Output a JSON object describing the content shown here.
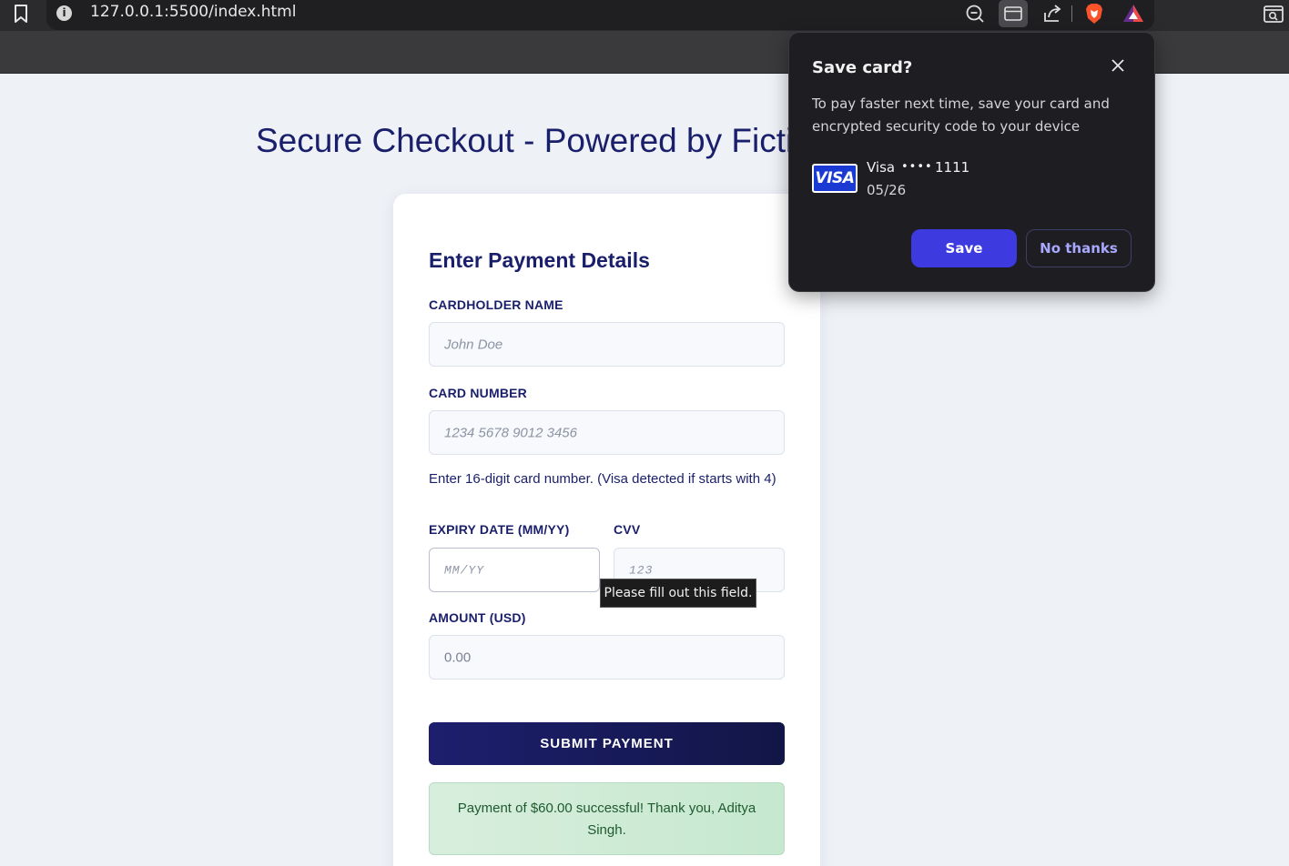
{
  "browser": {
    "url": "127.0.0.1:5500/index.html",
    "info_icon": "i",
    "icons": [
      "bookmark-icon",
      "info-icon",
      "zoom-out-icon",
      "credit-card-icon",
      "share-icon",
      "brave-shield-icon",
      "brave-rewards-icon",
      "tab-search-icon"
    ]
  },
  "page": {
    "title": "Secure Checkout - Powered by Fictio",
    "form_heading": "Enter Payment Details",
    "fields": {
      "cardholder_label": "CARDHOLDER NAME",
      "cardholder_placeholder": "John Doe",
      "card_number_label": "CARD NUMBER",
      "card_number_placeholder": "1234 5678 9012 3456",
      "card_number_hint": "Enter 16-digit card number. (Visa detected if starts with 4)",
      "expiry_label": "EXPIRY DATE (MM/YY)",
      "expiry_placeholder": "MM/YY",
      "cvv_label": "CVV",
      "cvv_placeholder": "123",
      "amount_label": "AMOUNT (USD)",
      "amount_placeholder": "0.00"
    },
    "validation_tooltip": "Please fill out this field.",
    "submit_label": "SUBMIT PAYMENT",
    "success_message": "Payment of $60.00 successful! Thank you, Aditya Singh."
  },
  "save_card_popup": {
    "title": "Save card?",
    "description": "To pay faster next time, save your card and encrypted security code to your device",
    "card_logo": "VISA",
    "card_brand": "Visa",
    "card_dots": "••••",
    "card_last4": "1111",
    "card_expiry": "05/26",
    "save_label": "Save",
    "no_thanks_label": "No thanks"
  },
  "colors": {
    "accent": "#3d3ae0",
    "brand_navy": "#1a1f6b",
    "success_bg": "#d8eedd",
    "popup_bg": "#1e1e22"
  }
}
